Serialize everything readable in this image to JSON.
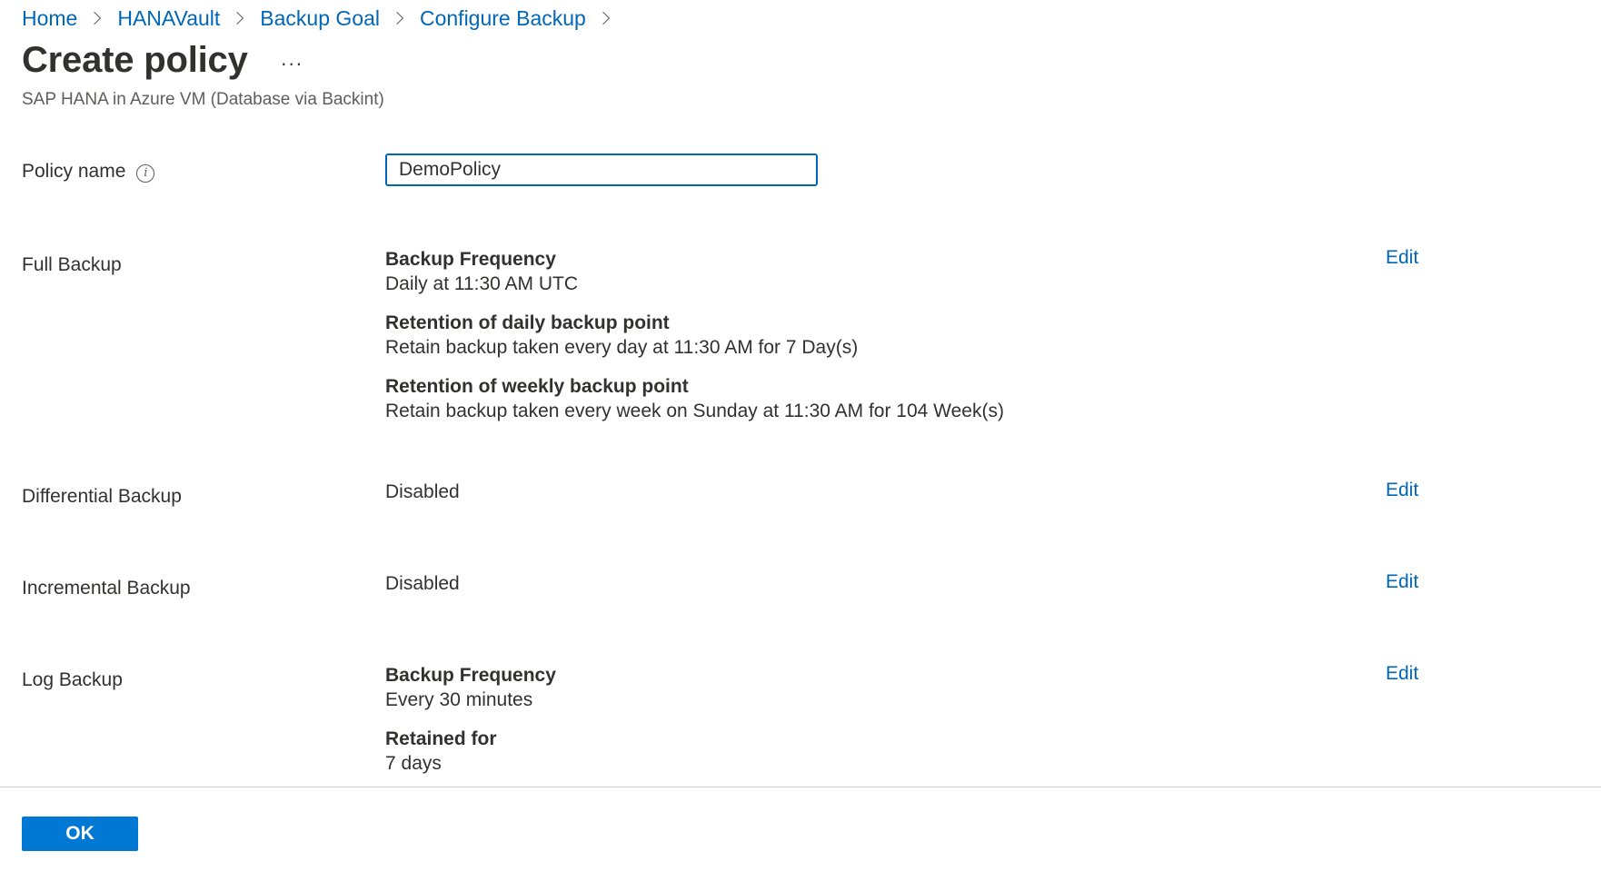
{
  "breadcrumb": {
    "items": [
      "Home",
      "HANAVault",
      "Backup Goal",
      "Configure Backup"
    ]
  },
  "header": {
    "title": "Create policy",
    "more_label": "···",
    "subtitle": "SAP HANA in Azure VM (Database via Backint)"
  },
  "policy_name": {
    "label": "Policy name",
    "value": "DemoPolicy"
  },
  "full_backup": {
    "label": "Full Backup",
    "frequency_heading": "Backup Frequency",
    "frequency_value": "Daily at 11:30 AM UTC",
    "daily_heading": "Retention of daily backup point",
    "daily_value": "Retain backup taken every day at 11:30 AM for 7 Day(s)",
    "weekly_heading": "Retention of weekly backup point",
    "weekly_value": "Retain backup taken every week on Sunday at 11:30 AM for 104 Week(s)",
    "edit_label": "Edit"
  },
  "differential_backup": {
    "label": "Differential Backup",
    "value": "Disabled",
    "edit_label": "Edit"
  },
  "incremental_backup": {
    "label": "Incremental Backup",
    "value": "Disabled",
    "edit_label": "Edit"
  },
  "log_backup": {
    "label": "Log Backup",
    "frequency_heading": "Backup Frequency",
    "frequency_value": "Every 30 minutes",
    "retained_heading": "Retained for",
    "retained_value": "7 days",
    "edit_label": "Edit"
  },
  "footer": {
    "ok_label": "OK"
  },
  "colors": {
    "accent": "#0078d4",
    "link": "#0067b8",
    "text": "#323130"
  }
}
